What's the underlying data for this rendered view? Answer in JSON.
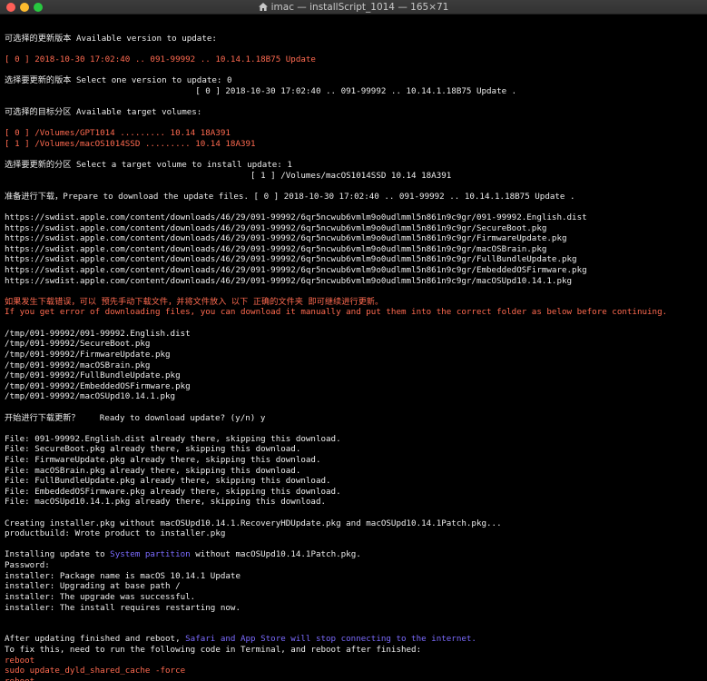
{
  "window": {
    "title": "imac — installScript_1014 — 165×71",
    "home_icon": "home-icon",
    "controls": [
      "close-button",
      "minimize-button",
      "zoom-button"
    ]
  },
  "colors": {
    "background": "#000000",
    "text": "#ececec",
    "orange": "#ff6a50",
    "blue": "#7b6bff"
  },
  "terminal": {
    "lines": [
      [],
      [
        {
          "t": "可选择的更新版本 Available version to update:",
          "c": "t"
        }
      ],
      [],
      [
        {
          "t": "[ 0 ] 2018-10-30 17:02:40 .. 091-99992 .. 10.14.1.18B75 Update",
          "c": "o"
        }
      ],
      [],
      [
        {
          "t": "选择要更新的版本 Select one version to update: 0",
          "c": "t"
        }
      ],
      [
        {
          "t": "                                      [ 0 ] 2018-10-30 17:02:40 .. 091-99992 .. 10.14.1.18B75 Update .",
          "c": "t"
        }
      ],
      [],
      [
        {
          "t": "可选择的目标分区 Available target volumes:",
          "c": "t"
        }
      ],
      [],
      [
        {
          "t": "[ 0 ] /Volumes/GPT1014 ......... 10.14 18A391",
          "c": "o"
        }
      ],
      [
        {
          "t": "[ 1 ] /Volumes/macOS1014SSD ......... 10.14 18A391",
          "c": "o"
        }
      ],
      [],
      [
        {
          "t": "选择要更新的分区 Select a target volume to install update: 1",
          "c": "t"
        }
      ],
      [
        {
          "t": "                                                 [ 1 ] /Volumes/macOS1014SSD 10.14 18A391",
          "c": "t"
        }
      ],
      [],
      [
        {
          "t": "准备进行下载，Prepare to download the update files. [ 0 ] 2018-10-30 17:02:40 .. 091-99992 .. 10.14.1.18B75 Update .",
          "c": "t"
        }
      ],
      [],
      [
        {
          "t": "https://swdist.apple.com/content/downloads/46/29/091-99992/6qr5ncwub6vmlm9o0udlmml5n861n9c9gr/091-99992.English.dist",
          "c": "t"
        }
      ],
      [
        {
          "t": "https://swdist.apple.com/content/downloads/46/29/091-99992/6qr5ncwub6vmlm9o0udlmml5n861n9c9gr/SecureBoot.pkg",
          "c": "t"
        }
      ],
      [
        {
          "t": "https://swdist.apple.com/content/downloads/46/29/091-99992/6qr5ncwub6vmlm9o0udlmml5n861n9c9gr/FirmwareUpdate.pkg",
          "c": "t"
        }
      ],
      [
        {
          "t": "https://swdist.apple.com/content/downloads/46/29/091-99992/6qr5ncwub6vmlm9o0udlmml5n861n9c9gr/macOSBrain.pkg",
          "c": "t"
        }
      ],
      [
        {
          "t": "https://swdist.apple.com/content/downloads/46/29/091-99992/6qr5ncwub6vmlm9o0udlmml5n861n9c9gr/FullBundleUpdate.pkg",
          "c": "t"
        }
      ],
      [
        {
          "t": "https://swdist.apple.com/content/downloads/46/29/091-99992/6qr5ncwub6vmlm9o0udlmml5n861n9c9gr/EmbeddedOSFirmware.pkg",
          "c": "t"
        }
      ],
      [
        {
          "t": "https://swdist.apple.com/content/downloads/46/29/091-99992/6qr5ncwub6vmlm9o0udlmml5n861n9c9gr/macOSUpd10.14.1.pkg",
          "c": "t"
        }
      ],
      [],
      [
        {
          "t": "如果发生下载错误，可以 预先手动下载文件，并将文件放入 以下 正确的文件夹 即可继续进行更新。",
          "c": "o"
        }
      ],
      [
        {
          "t": "If you get error of downloading files, you can download it manually and put them into the correct folder as below before continuing.",
          "c": "o"
        }
      ],
      [],
      [
        {
          "t": "/tmp/091-99992/091-99992.English.dist",
          "c": "t"
        }
      ],
      [
        {
          "t": "/tmp/091-99992/SecureBoot.pkg",
          "c": "t"
        }
      ],
      [
        {
          "t": "/tmp/091-99992/FirmwareUpdate.pkg",
          "c": "t"
        }
      ],
      [
        {
          "t": "/tmp/091-99992/macOSBrain.pkg",
          "c": "t"
        }
      ],
      [
        {
          "t": "/tmp/091-99992/FullBundleUpdate.pkg",
          "c": "t"
        }
      ],
      [
        {
          "t": "/tmp/091-99992/EmbeddedOSFirmware.pkg",
          "c": "t"
        }
      ],
      [
        {
          "t": "/tmp/091-99992/macOSUpd10.14.1.pkg",
          "c": "t"
        }
      ],
      [],
      [
        {
          "t": "开始进行下载更新？    Ready to download update? (y/n) y",
          "c": "t"
        }
      ],
      [],
      [
        {
          "t": "File: 091-99992.English.dist already there, skipping this download.",
          "c": "t"
        }
      ],
      [
        {
          "t": "File: SecureBoot.pkg already there, skipping this download.",
          "c": "t"
        }
      ],
      [
        {
          "t": "File: FirmwareUpdate.pkg already there, skipping this download.",
          "c": "t"
        }
      ],
      [
        {
          "t": "File: macOSBrain.pkg already there, skipping this download.",
          "c": "t"
        }
      ],
      [
        {
          "t": "File: FullBundleUpdate.pkg already there, skipping this download.",
          "c": "t"
        }
      ],
      [
        {
          "t": "File: EmbeddedOSFirmware.pkg already there, skipping this download.",
          "c": "t"
        }
      ],
      [
        {
          "t": "File: macOSUpd10.14.1.pkg already there, skipping this download.",
          "c": "t"
        }
      ],
      [],
      [
        {
          "t": "Creating installer.pkg without macOSUpd10.14.1.RecoveryHDUpdate.pkg and macOSUpd10.14.1Patch.pkg...",
          "c": "t"
        }
      ],
      [
        {
          "t": "productbuild: Wrote product to installer.pkg",
          "c": "t"
        }
      ],
      [],
      [
        {
          "t": "Installing update to ",
          "c": "t"
        },
        {
          "t": "System partition",
          "c": "b"
        },
        {
          "t": " without macOSUpd10.14.1Patch.pkg.",
          "c": "t"
        }
      ],
      [
        {
          "t": "Password:",
          "c": "t"
        }
      ],
      [
        {
          "t": "installer: Package name is macOS 10.14.1 Update",
          "c": "t"
        }
      ],
      [
        {
          "t": "installer: Upgrading at base path /",
          "c": "t"
        }
      ],
      [
        {
          "t": "installer: The upgrade was successful.",
          "c": "t"
        }
      ],
      [
        {
          "t": "installer: The install requires restarting now.",
          "c": "t"
        }
      ],
      [],
      [],
      [
        {
          "t": "After updating finished and reboot, ",
          "c": "t"
        },
        {
          "t": "Safari and App Store will stop connecting to the internet.",
          "c": "b"
        }
      ],
      [
        {
          "t": "To fix this, need to run the following code in Terminal, and reboot after finished:",
          "c": "t"
        }
      ],
      [
        {
          "t": "reboot",
          "c": "o"
        }
      ],
      [
        {
          "t": "sudo update_dyld_shared_cache -force",
          "c": "o"
        }
      ],
      [
        {
          "t": "reboot",
          "c": "o"
        }
      ]
    ]
  }
}
